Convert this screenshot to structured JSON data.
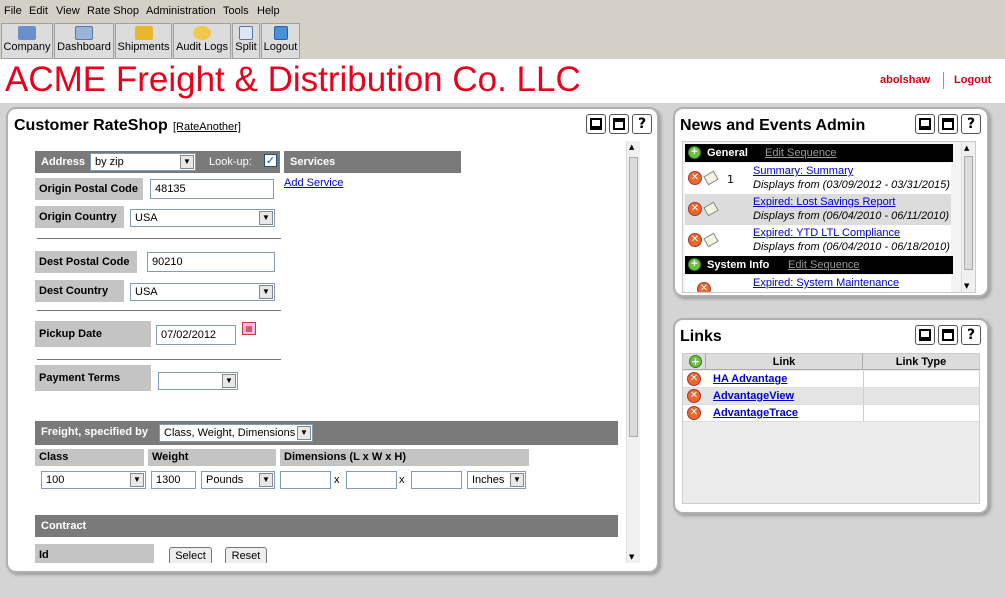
{
  "menu": [
    "File",
    "Edit",
    "View",
    "Rate Shop",
    "Administration",
    "Tools",
    "Help"
  ],
  "toolbar": [
    {
      "label": "Company",
      "icon": "company-icon"
    },
    {
      "label": "Dashboard",
      "icon": "dashboard-icon"
    },
    {
      "label": "Shipments",
      "icon": "shipments-icon"
    },
    {
      "label": "Audit Logs",
      "icon": "audit-logs-icon"
    },
    {
      "label": "Split",
      "icon": "split-icon"
    },
    {
      "label": "Logout",
      "icon": "logout-icon"
    }
  ],
  "header": {
    "brand": "ACME Freight & Distribution Co. LLC",
    "user": "abolshaw",
    "logout": "Logout",
    "brand_color": "#e8001c"
  },
  "rateshop": {
    "title": "Customer RateShop",
    "rate_another": "[RateAnother]",
    "address_label": "Address",
    "address_value": "by zip",
    "lookup_label": "Look-up:",
    "lookup_checked": true,
    "services_label": "Services",
    "add_service": "Add Service",
    "origin_postal_label": "Origin Postal Code",
    "origin_postal_value": "48135",
    "origin_country_label": "Origin Country",
    "origin_country_value": "USA",
    "dest_postal_label": "Dest Postal Code",
    "dest_postal_value": "90210",
    "dest_country_label": "Dest Country",
    "dest_country_value": "USA",
    "pickup_label": "Pickup Date",
    "pickup_value": "07/02/2012",
    "payment_label": "Payment Terms",
    "payment_value": "",
    "freight_label": "Freight, specified by",
    "freight_value": "Class, Weight, Dimensions",
    "class_label": "Class",
    "class_value": "100",
    "weight_label": "Weight",
    "weight_value": "1300",
    "weight_unit": "Pounds",
    "dims_label": "Dimensions (L x W x H)",
    "dims_x": "x",
    "dims_unit": "Inches",
    "contract_label": "Contract",
    "id_label": "Id",
    "select_btn": "Select",
    "reset_btn": "Reset"
  },
  "news": {
    "title": "News and Events Admin",
    "sections": [
      {
        "name": "General",
        "edit": "Edit Sequence",
        "items": [
          {
            "seq": "1",
            "title": "Summary: Summary",
            "dates": "Displays from (03/09/2012 - 03/31/2015)"
          },
          {
            "seq": "",
            "title": "Expired: Lost Savings Report",
            "dates": "Displays from (06/04/2010 - 06/11/2010)"
          },
          {
            "seq": "",
            "title": "Expired: YTD LTL Compliance",
            "dates": "Displays from (06/04/2010 - 06/18/2010)"
          }
        ]
      },
      {
        "name": "System Info",
        "edit": "Edit Sequence",
        "items": [
          {
            "seq": "",
            "title": "Expired: System Maintenance",
            "dates": ""
          }
        ]
      }
    ]
  },
  "links": {
    "title": "Links",
    "col_link": "Link",
    "col_type": "Link Type",
    "rows": [
      {
        "name": "HA Advantage",
        "type": ""
      },
      {
        "name": "AdvantageView",
        "type": ""
      },
      {
        "name": "AdvantageTrace",
        "type": ""
      }
    ]
  }
}
